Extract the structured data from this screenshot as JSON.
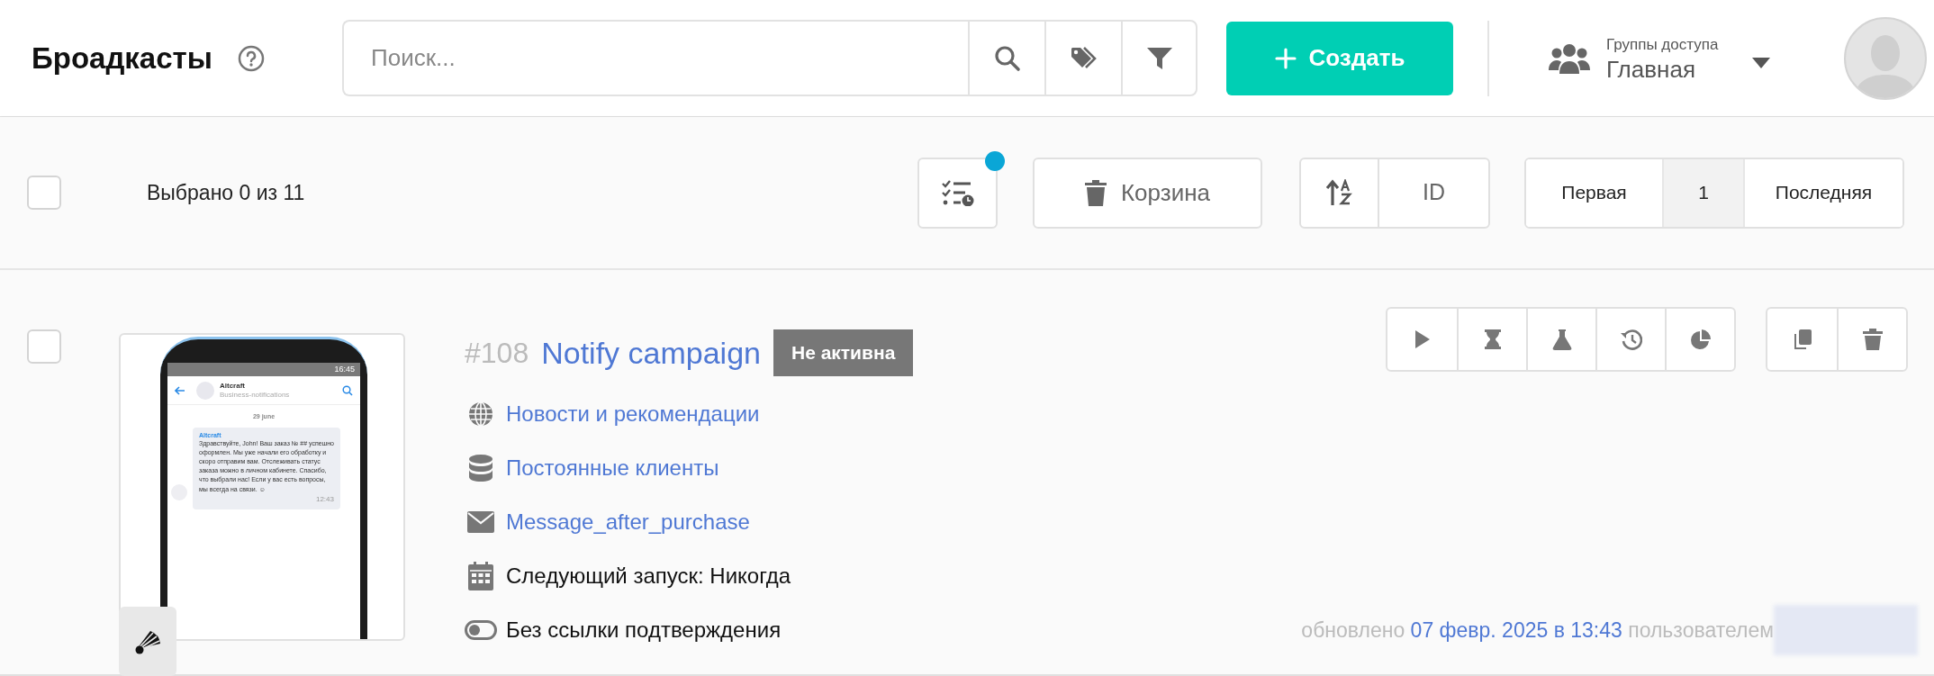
{
  "header": {
    "title": "Броадкасты",
    "search": {
      "placeholder": "Поиск..."
    },
    "create_button": "Создать",
    "access_group": {
      "label": "Группы доступа",
      "value": "Главная"
    }
  },
  "toolbar": {
    "select_all": {
      "checked": false
    },
    "selection_text": "Выбрано 0 из 11",
    "trash_button": "Корзина",
    "sort": {
      "field": "ID"
    },
    "pagination": [
      {
        "label": "Первая",
        "selected": false
      },
      {
        "label": "1",
        "selected": true
      },
      {
        "label": "Последняя",
        "selected": false
      }
    ]
  },
  "broadcasts": [
    {
      "checked": false,
      "id": "#108",
      "name": "Notify campaign",
      "status": "Не активна",
      "active": false,
      "preview": {
        "time": "16:45",
        "sender": "Altcraft",
        "subtitle": "Business-notifications",
        "date": "29 june",
        "message_sender": "Altcraft",
        "message": "Здравствуйте, John! Ваш заказ № ## успешно оформлен.  Мы уже начали его обработку и скоро отправим вам. Отслеживать статус заказа можно в личном кабинете. Спасибо, что выбрали нас! Если у вас есть вопросы, мы всегда на связи. ☺",
        "message_time": "12:43"
      },
      "details": [
        {
          "kind": "globe",
          "text": "Новости и рекомендации",
          "link": true
        },
        {
          "kind": "database",
          "text": "Постоянные клиенты",
          "link": true
        },
        {
          "kind": "envelope",
          "text": "Message_after_purchase",
          "link": true
        },
        {
          "kind": "calendar",
          "text": "Следующий запуск: Никогда",
          "link": false
        },
        {
          "kind": "toggle",
          "text": "Без ссылки подтверждения",
          "link": false
        }
      ],
      "updated": {
        "prefix": "обновлено",
        "date": "07 февр. 2025 в 13:43",
        "suffix": "пользователем"
      }
    }
  ]
}
